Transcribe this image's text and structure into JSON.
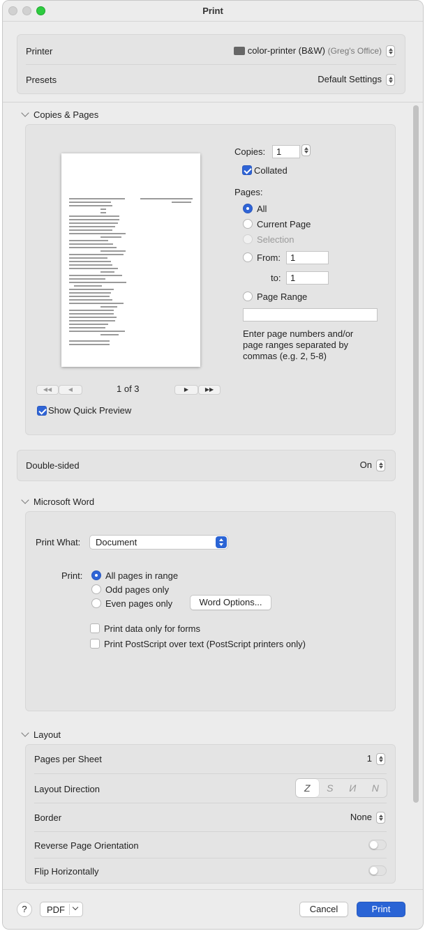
{
  "window": {
    "title": "Print"
  },
  "printer_box": {
    "printer_label": "Printer",
    "printer_name": "color-printer (B&W)",
    "printer_location": "(Greg's Office)",
    "presets_label": "Presets",
    "presets_value": "Default Settings"
  },
  "copies_pages": {
    "header": "Copies & Pages",
    "copies_label": "Copies:",
    "copies_value": "1",
    "collated_label": "Collated",
    "collated_checked": true,
    "pages_label": "Pages:",
    "page_options": [
      {
        "label": "All",
        "state": "selected"
      },
      {
        "label": "Current Page",
        "state": "unselected"
      },
      {
        "label": "Selection",
        "state": "disabled"
      },
      {
        "label": "From:",
        "state": "unselected"
      }
    ],
    "from_value": "1",
    "to_label": "to:",
    "to_value": "1",
    "page_range_label": "Page Range",
    "page_range_value": "",
    "help_text": "Enter page numbers and/or page ranges separated by commas (e.g. 2, 5-8)",
    "page_indicator": "1 of 3",
    "show_quick_preview_label": "Show Quick Preview",
    "show_quick_preview_checked": true
  },
  "double_sided": {
    "label": "Double-sided",
    "value": "On"
  },
  "microsoft_word": {
    "header": "Microsoft Word",
    "print_what_label": "Print What:",
    "print_what_value": "Document",
    "print_label": "Print:",
    "print_options": [
      {
        "label": "All pages in range",
        "state": "selected"
      },
      {
        "label": "Odd pages only",
        "state": "unselected"
      },
      {
        "label": "Even pages only",
        "state": "unselected"
      }
    ],
    "word_options_button": "Word Options...",
    "checkbox_forms_label": "Print data only for forms",
    "checkbox_postscript_label": "Print PostScript over text (PostScript printers only)"
  },
  "layout": {
    "header": "Layout",
    "pages_per_sheet_label": "Pages per Sheet",
    "pages_per_sheet_value": "1",
    "layout_direction_label": "Layout Direction",
    "layout_direction_icons": [
      "Z-icon",
      "S-reverse-icon",
      "N-reverse-icon",
      "N-icon"
    ],
    "border_label": "Border",
    "border_value": "None",
    "reverse_label": "Reverse Page Orientation",
    "reverse_on": false,
    "flip_label": "Flip Horizontally",
    "flip_on": false
  },
  "bottom": {
    "help_label": "?",
    "pdf_label": "PDF",
    "cancel_label": "Cancel",
    "print_label": "Print"
  },
  "colors": {
    "accent": "#2a64d5",
    "window_bg": "#ececec",
    "panel_bg": "#e4e4e4"
  }
}
